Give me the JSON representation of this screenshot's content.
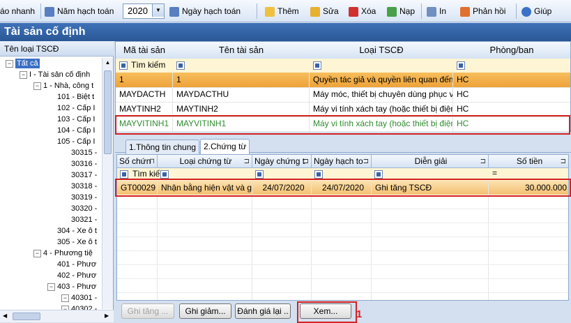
{
  "toolbar": {
    "quick_label": "áo nhanh",
    "year_label": "Năm hạch toán",
    "year_value": "2020",
    "date_label": "Ngày hạch toán",
    "add_label": "Thêm",
    "edit_label": "Sửa",
    "delete_label": "Xóa",
    "load_label": "Nạp",
    "print_label": "In",
    "feedback_label": "Phản hồi",
    "help_label": "Giúp"
  },
  "title": "Tài sản cố định",
  "left": {
    "header": "Tên loại TSCĐ",
    "items": [
      {
        "label": "Tất cả",
        "level": 0
      },
      {
        "label": "I - Tài sản cố định",
        "level": 1
      },
      {
        "label": "1 - Nhà, công t",
        "level": 2
      },
      {
        "label": "101 - Biệt t",
        "level": 3
      },
      {
        "label": "102 - Cấp I",
        "level": 3
      },
      {
        "label": "103 - Cấp I",
        "level": 3
      },
      {
        "label": "104 - Cấp I",
        "level": 3
      },
      {
        "label": "105 - Cấp I",
        "level": 3
      },
      {
        "label": "30315 -",
        "level": 4
      },
      {
        "label": "30316 -",
        "level": 4
      },
      {
        "label": "30317 -",
        "level": 4
      },
      {
        "label": "30318 -",
        "level": 4
      },
      {
        "label": "30319 -",
        "level": 4
      },
      {
        "label": "30320 -",
        "level": 4
      },
      {
        "label": "30321 -",
        "level": 4
      },
      {
        "label": "304 - Xe ô t",
        "level": 3
      },
      {
        "label": "305 - Xe ô t",
        "level": 3
      },
      {
        "label": "4 - Phương tiệ",
        "level": 2
      },
      {
        "label": "401 - Phươ",
        "level": 3
      },
      {
        "label": "402 - Phươ",
        "level": 3
      },
      {
        "label": "403 - Phươ",
        "level": 3
      },
      {
        "label": "40301 -",
        "level": 4
      },
      {
        "label": "40302 -",
        "level": 4
      }
    ]
  },
  "grid": {
    "columns": [
      "Mã tài sản",
      "Tên tài sản",
      "Loại TSCĐ",
      "Phòng/ban"
    ],
    "search_label": "Tìm kiếm",
    "rows": [
      [
        "1",
        "1",
        "Quyền tác giả và quyền liên quan đến",
        "HC"
      ],
      [
        "MAYDACTH",
        "MAYDACTHU",
        "Máy móc, thiết bị chuyên dùng phục vụ",
        "HC"
      ],
      [
        "MAYTINH2",
        "MAYTINH2",
        "Máy vi tính xách tay (hoặc thiết bị điện",
        "HC"
      ],
      [
        "MAYVITINH1",
        "MAYVITINH1",
        "Máy vi tính xách tay (hoặc thiết bị điện",
        "HC"
      ]
    ]
  },
  "tabs": [
    "1.Thông tin chung",
    "2.Chứng từ"
  ],
  "vouchers": {
    "columns": [
      "Số chứn",
      "Loại chứng từ",
      "Ngày chứng t",
      "Ngày hạch to",
      "Diễn giải",
      "Số tiền"
    ],
    "search_label": "Tìm kiếm",
    "rows": [
      [
        "GT00029",
        "Nhận bằng hiện vật và g...",
        "24/07/2020",
        "24/07/2020",
        "Ghi tăng TSCĐ",
        "30.000.000"
      ]
    ]
  },
  "buttons": {
    "increase": "Ghi tăng ...",
    "decrease": "Ghi giảm...",
    "revalue": "Đánh giá lại ..",
    "view": "Xem..."
  },
  "annotation_number": "1",
  "colors": {
    "accent": "#2a5795",
    "highlight_red": "#d42020",
    "selected_row": "#f0a030"
  }
}
